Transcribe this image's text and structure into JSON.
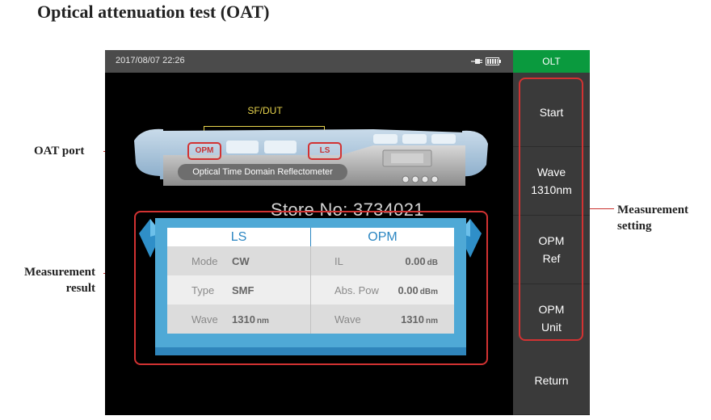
{
  "page": {
    "heading": "Optical attenuation test (OAT)"
  },
  "callouts": {
    "oat_port": "OAT port",
    "measurement_result_line1": "Measurement",
    "measurement_result_line2": "result",
    "measurement_setting_line1": "Measurement",
    "measurement_setting_line2": "setting"
  },
  "status_bar": {
    "datetime": "2017/08/07 22:26",
    "icons": [
      "plug-icon",
      "battery-icon"
    ],
    "battery_level": 1.0
  },
  "illustration": {
    "sfdut_label": "SF/DUT",
    "port_left": "OPM",
    "port_right": "LS",
    "device_name": "Optical Time Domain Reflectometer"
  },
  "watermark": "Store No: 3734021",
  "result_table": {
    "headers": [
      "LS",
      "OPM"
    ],
    "rows": [
      {
        "ls_key": "Mode",
        "ls_value": "CW",
        "ls_unit": "",
        "opm_key": "IL",
        "opm_value": "0.00",
        "opm_unit": "dB"
      },
      {
        "ls_key": "Type",
        "ls_value": "SMF",
        "ls_unit": "",
        "opm_key": "Abs. Pow",
        "opm_value": "0.00",
        "opm_unit": "dBm"
      },
      {
        "ls_key": "Wave",
        "ls_value": "1310",
        "ls_unit": "nm",
        "opm_key": "Wave",
        "opm_value": "1310",
        "opm_unit": "nm"
      }
    ]
  },
  "sidebar": {
    "tab": "OLT",
    "start": "Start",
    "wave_line1": "Wave",
    "wave_line2": "1310nm",
    "opm_ref_line1": "OPM",
    "opm_ref_line2": "Ref",
    "opm_unit_line1": "OPM",
    "opm_unit_line2": "Unit",
    "return": "Return"
  },
  "colors": {
    "accent_green": "#0a9a3e",
    "callout_red": "#d23232",
    "panel_blue": "#4fa9d6",
    "sfdut_yellow": "#e8d44d"
  }
}
